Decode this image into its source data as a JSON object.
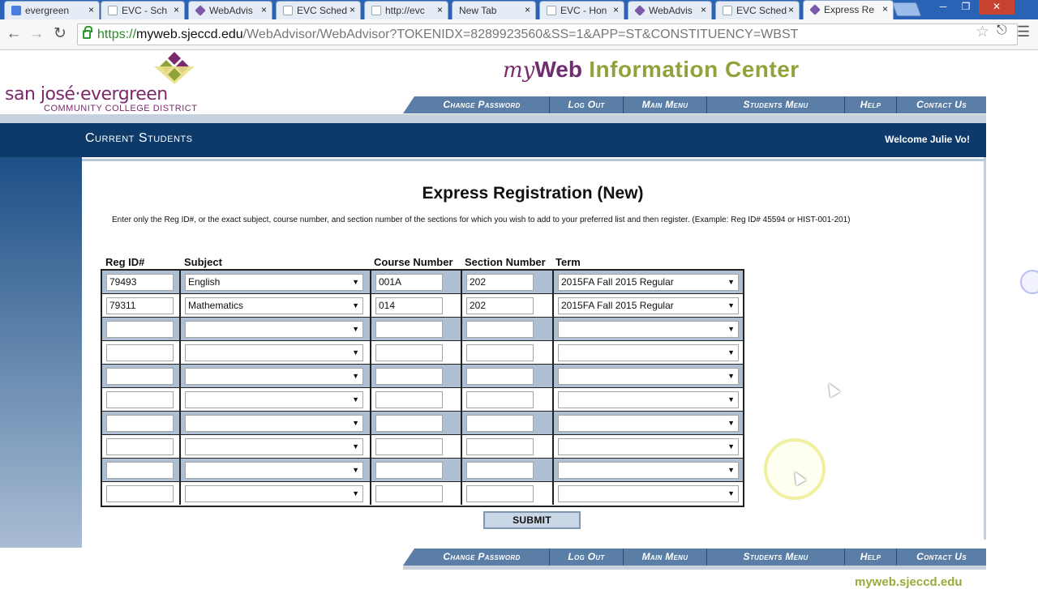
{
  "browser": {
    "tabs": [
      {
        "label": "evergreen",
        "icon": "google-g-icon"
      },
      {
        "label": "EVC - Sch",
        "icon": "doc-icon"
      },
      {
        "label": "WebAdvis",
        "icon": "webadvisor-icon"
      },
      {
        "label": "EVC Sched",
        "icon": "doc-icon"
      },
      {
        "label": "http://evc",
        "icon": "doc-icon"
      },
      {
        "label": "New Tab",
        "icon": ""
      },
      {
        "label": "EVC - Hon",
        "icon": "doc-icon"
      },
      {
        "label": "WebAdvis",
        "icon": "webadvisor-icon"
      },
      {
        "label": "EVC Sched",
        "icon": "doc-icon"
      },
      {
        "label": "Express Re",
        "icon": "webadvisor-icon"
      }
    ],
    "active_tab_index": 9,
    "close_glyph": "×",
    "url_scheme": "https://",
    "url_host": "myweb.sjeccd.edu",
    "url_path": "/WebAdvisor/WebAdvisor?TOKENIDX=8289923560&SS=1&APP=ST&CONSTITUENCY=WBST"
  },
  "header": {
    "logo_line1": "san josé·evergreen",
    "logo_line2": "COMMUNITY COLLEGE DISTRICT",
    "brand_my": "my",
    "brand_web": "Web",
    "brand_info": " Information Center",
    "nav": [
      "Change Password",
      "Log Out",
      "Main Menu",
      "Students Menu",
      "Help",
      "Contact Us"
    ]
  },
  "banner": {
    "title": "Current Students",
    "welcome": "Welcome Julie Vo!"
  },
  "form": {
    "title": "Express Registration (New)",
    "instructions": "Enter only the Reg ID#, or the exact subject, course number, and section number of the sections for which you wish to add to your preferred list and then register. (Example: Reg ID# 45594 or HIST-001-201)",
    "columns": [
      "Reg ID#",
      "Subject",
      "Course Number",
      "Section Number",
      "Term"
    ],
    "rows": [
      {
        "reg_id": "79493",
        "subject": "English",
        "course": "001A",
        "section": "202",
        "term": "2015FA Fall 2015 Regular"
      },
      {
        "reg_id": "79311",
        "subject": "Mathematics",
        "course": "014",
        "section": "202",
        "term": "2015FA Fall 2015 Regular"
      },
      {
        "reg_id": "",
        "subject": "",
        "course": "",
        "section": "",
        "term": ""
      },
      {
        "reg_id": "",
        "subject": "",
        "course": "",
        "section": "",
        "term": ""
      },
      {
        "reg_id": "",
        "subject": "",
        "course": "",
        "section": "",
        "term": ""
      },
      {
        "reg_id": "",
        "subject": "",
        "course": "",
        "section": "",
        "term": ""
      },
      {
        "reg_id": "",
        "subject": "",
        "course": "",
        "section": "",
        "term": ""
      },
      {
        "reg_id": "",
        "subject": "",
        "course": "",
        "section": "",
        "term": ""
      },
      {
        "reg_id": "",
        "subject": "",
        "course": "",
        "section": "",
        "term": ""
      },
      {
        "reg_id": "",
        "subject": "",
        "course": "",
        "section": "",
        "term": ""
      }
    ],
    "submit_label": "SUBMIT"
  },
  "footer": {
    "url_fragment": "myweb.sjeccd.edu"
  },
  "colors": {
    "banner": "#0e3a6a",
    "nav_strip": "#5a7ea5",
    "row_shade": "#aebfd4",
    "brand_purple": "#6f2c70",
    "brand_green": "#8fa33a"
  }
}
